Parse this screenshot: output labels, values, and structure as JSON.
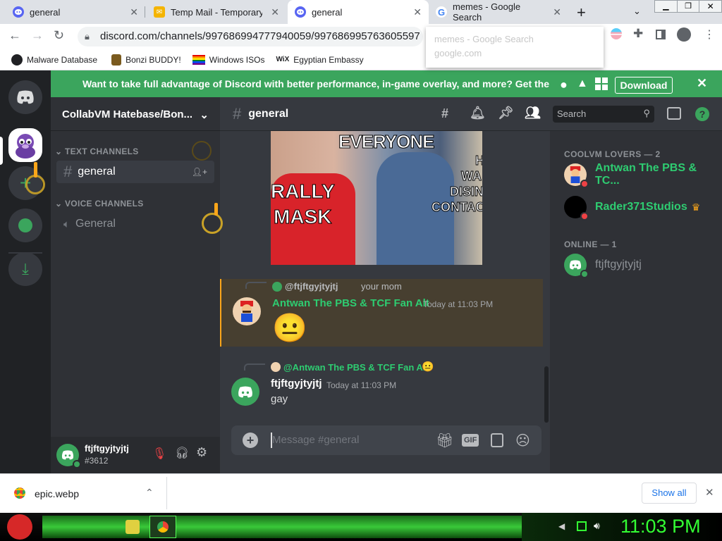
{
  "browser": {
    "tabs": [
      {
        "title": "general",
        "icon": "discord-icon",
        "active": false
      },
      {
        "title": "Temp Mail - Temporary Di",
        "icon": "temp-mail-icon",
        "active": false
      },
      {
        "title": "general",
        "icon": "discord-icon",
        "active": true
      },
      {
        "title": "memes - Google Search",
        "icon": "google-icon",
        "active": false
      }
    ],
    "url": "discord.com/channels/997686994777940059/997686995763605597",
    "suggestion": {
      "title": "memes - Google Search",
      "url": "google.com"
    },
    "bookmarks": [
      {
        "label": "Malware Database",
        "icon": "github-icon"
      },
      {
        "label": "Bonzi BUDDY!",
        "icon": "bonzi-icon"
      },
      {
        "label": "Windows ISOs",
        "icon": "rainbow-flag-icon"
      },
      {
        "label": "Egyptian Embassy",
        "icon": "wix-icon"
      }
    ]
  },
  "discord": {
    "banner_text": "Want to take full advantage of Discord with better performance, in-game overlay, and more? Get the desktop app!",
    "banner_button": "Download",
    "server_name": "CollabVM Hatebase/Bon...",
    "categories": {
      "text": "TEXT CHANNELS",
      "voice": "VOICE CHANNELS"
    },
    "channels": {
      "text_channel": "general",
      "voice_channel": "General"
    },
    "channel_title": "general",
    "search_placeholder": "Search",
    "meme_lines": {
      "top": "EVERYONE",
      "left1": "RALLY",
      "left2": "MASK",
      "right1": "H",
      "right2": "WA",
      "right3": "DISIN",
      "right4": "CONTACT"
    },
    "messages": [
      {
        "reply_to_user": "@ftjftgyjtyjtj",
        "reply_text": "your mom",
        "author": "Antwan The PBS & TCF Fan Alt",
        "timestamp": "Today at 11:03 PM",
        "content_emoji": "😐",
        "author_color": "#2ecc71"
      },
      {
        "reply_to_user": "@Antwan The PBS & TCF Fan Alt",
        "reply_text": "😐",
        "author": "ftjftgyjtyjtj",
        "timestamp": "Today at 11:03 PM",
        "content": "gay",
        "author_color": "#ffffff"
      }
    ],
    "input_placeholder": "Message #general",
    "user": {
      "name": "ftjftgyjtyjtj",
      "tag": "#3612"
    },
    "members": {
      "group1_title": "COOLVM LOVERS — 2",
      "group1": [
        {
          "name": "Antwan The PBS & TC...",
          "color": "#2ecc71"
        },
        {
          "name": "Rader371Studios",
          "color": "#2ecc71"
        }
      ],
      "group2_title": "ONLINE — 1",
      "group2": [
        {
          "name": "ftjftgyjtyjtj",
          "color": "#8e9297"
        }
      ]
    },
    "accent": "#5865f2",
    "banner_color": "#3ba55d"
  },
  "downloads": {
    "file_name": "epic.webp",
    "show_all": "Show all"
  },
  "taskbar": {
    "clock": "11:03 PM"
  }
}
